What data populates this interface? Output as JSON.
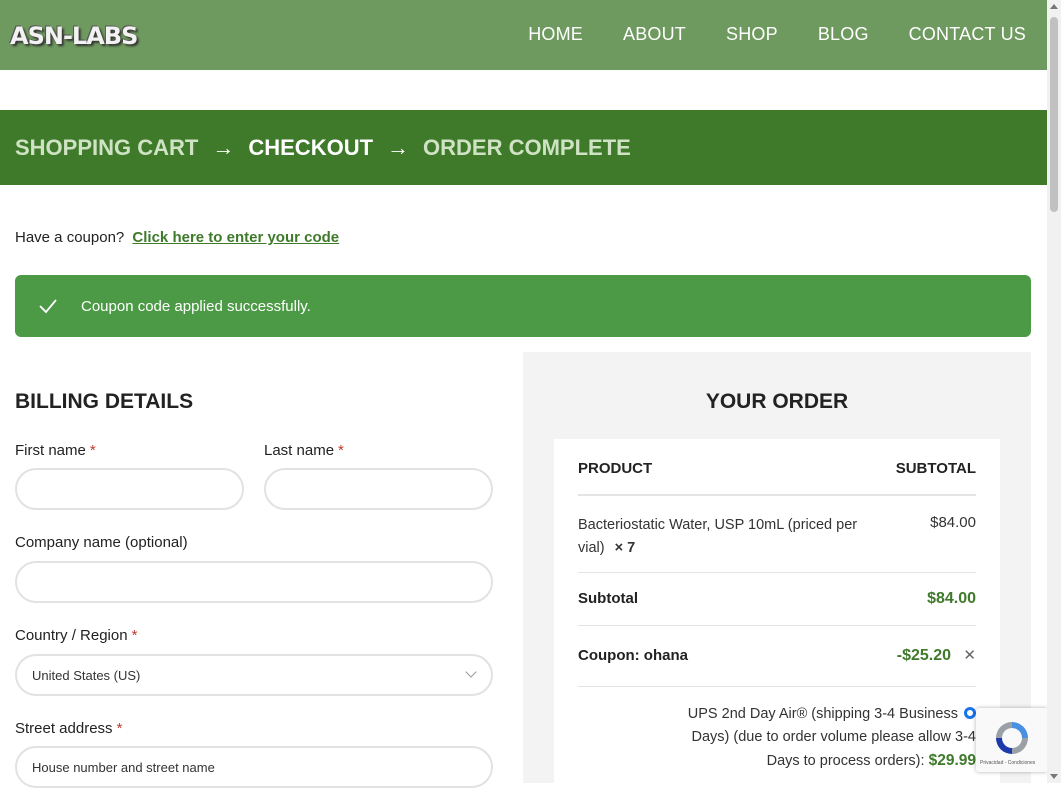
{
  "header": {
    "logo": "ASN-LABS",
    "nav": [
      "HOME",
      "ABOUT",
      "SHOP",
      "BLOG",
      "CONTACT US"
    ]
  },
  "steps": {
    "cart": "SHOPPING CART",
    "checkout": "CHECKOUT",
    "complete": "ORDER COMPLETE",
    "arrow": "→"
  },
  "coupon": {
    "prompt": "Have a coupon?",
    "link": "Click here to enter your code"
  },
  "notice": {
    "message": "Coupon code applied successfully."
  },
  "billing": {
    "title": "BILLING DETAILS",
    "first_name_label": "First name",
    "last_name_label": "Last name",
    "company_label": "Company name (optional)",
    "country_label": "Country / Region",
    "country_value": "United States (US)",
    "street_label": "Street address",
    "street_placeholder": "House number and street name",
    "required_mark": "*"
  },
  "order": {
    "title": "YOUR ORDER",
    "col_product": "PRODUCT",
    "col_subtotal": "SUBTOTAL",
    "item_name_line1": "Bacteriostatic Water, USP 10mL (priced per",
    "item_name_line2": "vial)",
    "item_qty": "× 7",
    "item_price": "$84.00",
    "subtotal_label": "Subtotal",
    "subtotal_value": "$84.00",
    "coupon_label": "Coupon: ohana",
    "coupon_value": "-$25.20",
    "remove_glyph": "✕",
    "shipping_line1": "UPS 2nd Day Air® (shipping 3-4 Business",
    "shipping_line2": "Days) (due to order volume please allow 3-4",
    "shipping_line3": "Days to process orders):",
    "shipping_price": "$29.99"
  },
  "recaptcha": {
    "footer": "Privacidad - Condiciones"
  },
  "colors": {
    "header_bg": "#6f9a5f",
    "steps_bg": "#3f7a2b",
    "notice_bg": "#4c9a45",
    "accent": "#3f7a2b"
  }
}
